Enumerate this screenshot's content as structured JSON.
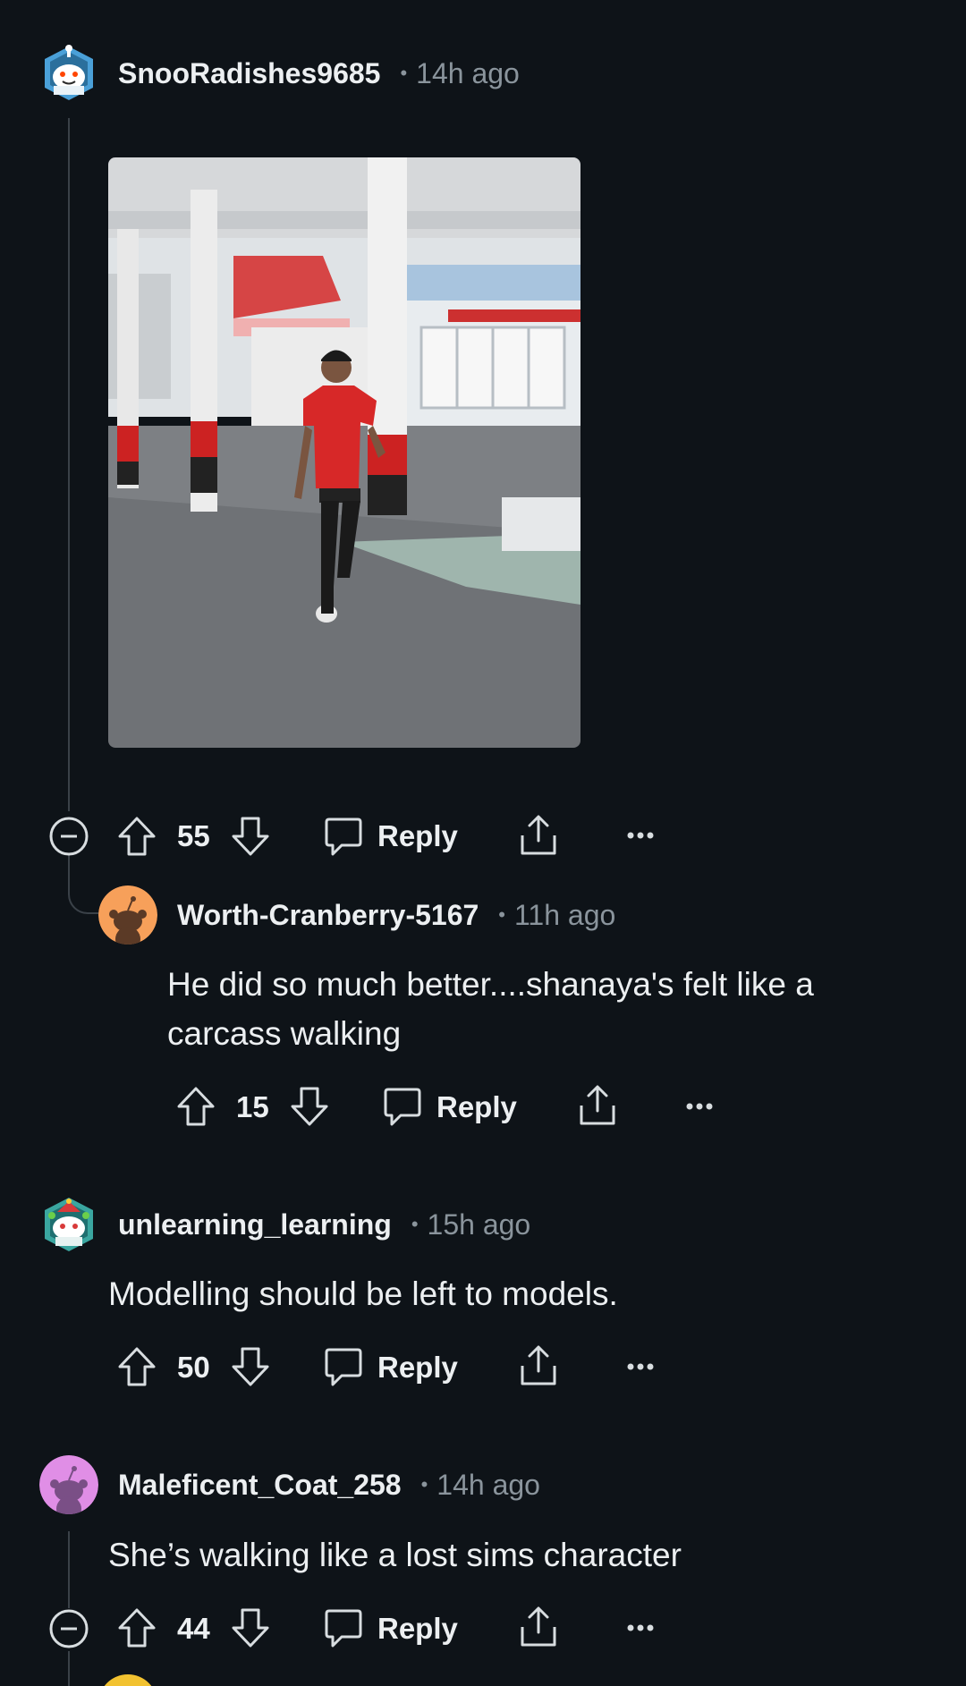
{
  "comments": [
    {
      "username": "SnooRadishes9685",
      "time": "14h ago",
      "avatar_icon": "snoo-robot-avatar-icon",
      "has_media": true,
      "votes": "55",
      "reply_label": "Reply",
      "replies": [
        {
          "username": "Worth-Cranberry-5167",
          "time": "11h ago",
          "avatar_icon": "snoo-orange-avatar-icon",
          "body_lines": [
            "He did so much better....shanaya's felt like a",
            "carcass walking"
          ],
          "votes": "15",
          "reply_label": "Reply"
        }
      ]
    },
    {
      "username": "unlearning_learning",
      "time": "15h ago",
      "avatar_icon": "snoo-festive-avatar-icon",
      "body": "Modelling should be left to models.",
      "votes": "50",
      "reply_label": "Reply"
    },
    {
      "username": "Maleficent_Coat_258",
      "time": "14h ago",
      "avatar_icon": "snoo-purple-avatar-icon",
      "body": "She’s walking like a lost sims character",
      "votes": "44",
      "reply_label": "Reply"
    }
  ],
  "colors": {
    "background": "#0e1318",
    "text": "#eceff1",
    "muted": "#8a949c",
    "thread_line": "#3a4148"
  }
}
